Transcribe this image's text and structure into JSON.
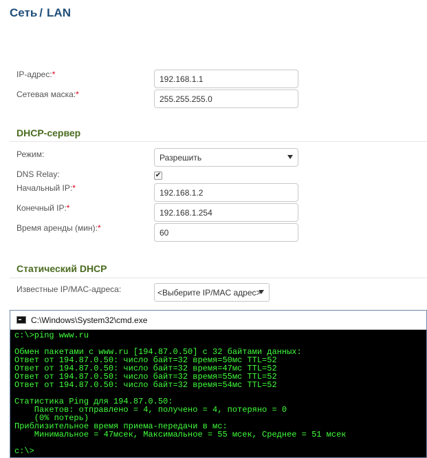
{
  "breadcrumb": {
    "root": "Сеть",
    "separator": "/",
    "current": "LAN"
  },
  "lan": {
    "ip_label": "IP-адрес:",
    "ip_value": "192.168.1.1",
    "mask_label": "Сетевая маска:",
    "mask_value": "255.255.255.0",
    "required_mark": "*"
  },
  "dhcp": {
    "title": "DHCP-сервер",
    "mode_label": "Режим:",
    "mode_value": "Разрешить",
    "dns_relay_label": "DNS Relay:",
    "dns_relay_checked": true,
    "check_glyph": "✔",
    "start_label": "Начальный IP:",
    "start_value": "192.168.1.2",
    "end_label": "Конечный IP:",
    "end_value": "192.168.1.254",
    "lease_label": "Время аренды (мин):",
    "lease_value": "60"
  },
  "static_dhcp": {
    "title": "Статический DHCP",
    "known_label": "Известные IP/MAC-адреса:",
    "known_value": "<Выберите IP/MAC адрес>"
  },
  "cmd": {
    "title": "C:\\Windows\\System32\\cmd.exe",
    "output": "c:\\>ping www.ru\n\nОбмен пакетами с www.ru [194.87.0.50] с 32 байтами данных:\nОтвет от 194.87.0.50: число байт=32 время=50мс TTL=52\nОтвет от 194.87.0.50: число байт=32 время=47мс TTL=52\nОтвет от 194.87.0.50: число байт=32 время=55мс TTL=52\nОтвет от 194.87.0.50: число байт=32 время=54мс TTL=52\n\nСтатистика Ping для 194.87.0.50:\n    Пакетов: отправлено = 4, получено = 4, потеряно = 0\n    (0% потерь)\nПриблизительное время приема-передачи в мс:\n    Минимальное = 47мсек, Максимальное = 55 мсек, Среднее = 51 мсек\n\nc:\\>"
  },
  "colors": {
    "title": "#1f4e79",
    "section": "#4a6b1f",
    "required": "#d9001b",
    "console_text": "#41ff3c"
  }
}
